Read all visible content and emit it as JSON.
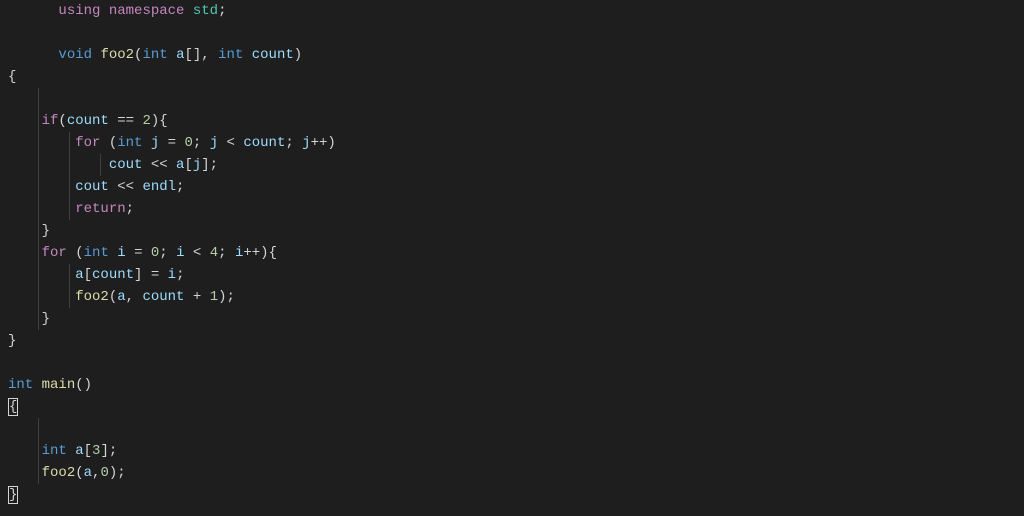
{
  "code": {
    "line1": {
      "using": "using",
      "namespace": "namespace",
      "std": "std",
      "semi": ";"
    },
    "line3": {
      "void": "void",
      "fn": "foo2",
      "lp": "(",
      "int1": "int",
      "a": "a",
      "brackets": "[]",
      "comma": ", ",
      "int2": "int",
      "count": "count",
      "rp": ")"
    },
    "line4": {
      "brace": "{"
    },
    "line6": {
      "if": "if",
      "lp": "(",
      "count": "count",
      "eq": " == ",
      "two": "2",
      "rp": ")",
      "brace": "{"
    },
    "line7": {
      "for": "for",
      "lp": " (",
      "int": "int",
      "j1": "j",
      "eq": " = ",
      "zero": "0",
      "semi1": "; ",
      "j2": "j",
      "lt": " < ",
      "count": "count",
      "semi2": "; ",
      "j3": "j",
      "inc": "++",
      "rp": ")"
    },
    "line8": {
      "cout": "cout",
      "op": " << ",
      "a": "a",
      "lb": "[",
      "j": "j",
      "rb": "]",
      "semi": ";"
    },
    "line9": {
      "cout": "cout",
      "op": " << ",
      "endl": "endl",
      "semi": ";"
    },
    "line10": {
      "return": "return",
      "semi": ";"
    },
    "line11": {
      "brace": "}"
    },
    "line12": {
      "for": "for",
      "lp": " (",
      "int": "int",
      "i1": "i",
      "eq": " = ",
      "zero": "0",
      "semi1": "; ",
      "i2": "i",
      "lt": " < ",
      "four": "4",
      "semi2": "; ",
      "i3": "i",
      "inc": "++",
      "rp": ")",
      "brace": "{"
    },
    "line13": {
      "a": "a",
      "lb": "[",
      "count": "count",
      "rb": "]",
      "eq": " = ",
      "i": "i",
      "semi": ";"
    },
    "line14": {
      "fn": "foo2",
      "lp": "(",
      "a": "a",
      "comma": ", ",
      "count": "count",
      "plus": " + ",
      "one": "1",
      "rp": ")",
      "semi": ";"
    },
    "line15": {
      "brace": "}"
    },
    "line16": {
      "brace": "}"
    },
    "line18": {
      "int": "int",
      "fn": "main",
      "parens": "()"
    },
    "line19": {
      "brace": "{"
    },
    "line21": {
      "int": "int",
      "a": "a",
      "lb": "[",
      "three": "3",
      "rb": "]",
      "semi": ";"
    },
    "line22": {
      "fn": "foo2",
      "lp": "(",
      "a": "a",
      "comma": ",",
      "zero": "0",
      "rp": ")",
      "semi": ";"
    },
    "line23": {
      "brace": "}"
    }
  }
}
